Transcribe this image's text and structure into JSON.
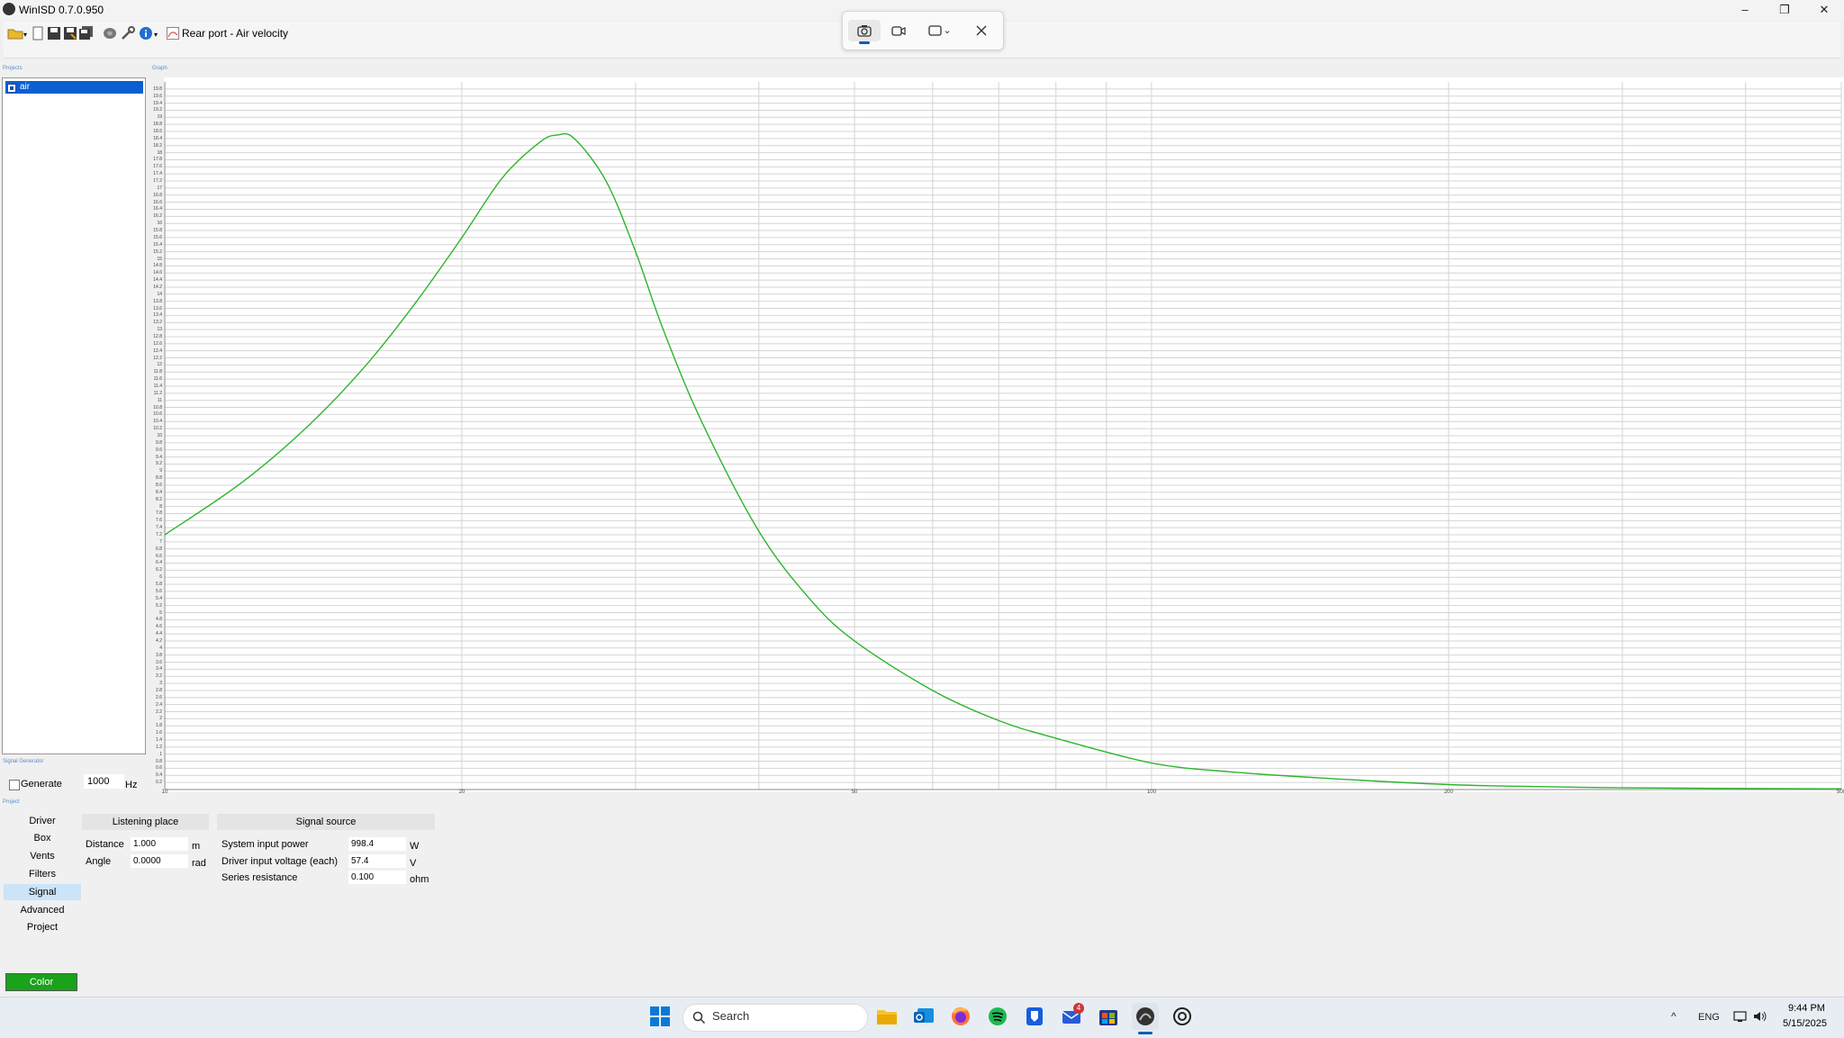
{
  "window": {
    "title": "WinISD 0.7.0.950",
    "icon": "winisd-app-icon",
    "controls": {
      "minimize": "–",
      "restore": "❐",
      "close": "✕"
    }
  },
  "toolbar": {
    "icons": [
      "open-folder-icon",
      "new-document-icon",
      "save-icon",
      "save-as-icon",
      "save-all-icon",
      "driver-database-icon",
      "tools-icon",
      "info-icon"
    ],
    "graph_selector_label": "Rear port - Air velocity",
    "graph_selector_icon": "graph-icon"
  },
  "snipping_tool": {
    "icons": [
      "camera-icon",
      "video-icon",
      "rectangle-mode-icon",
      "close-icon"
    ],
    "chevron": "⌄",
    "active_mode": "camera"
  },
  "projects_panel": {
    "label": "Projects",
    "items": [
      {
        "label": "air",
        "checked": true,
        "selected": true
      }
    ]
  },
  "graph_label": "Graph",
  "chart_data": {
    "type": "line",
    "x_scale": "log",
    "xlim": [
      10,
      500
    ],
    "ylim": [
      0,
      20
    ],
    "x_tick_labels": [
      {
        "value": 10,
        "label": "10"
      },
      {
        "value": 20,
        "label": "20"
      },
      {
        "value": 50,
        "label": "50"
      },
      {
        "value": 100,
        "label": "100"
      },
      {
        "value": 200,
        "label": "200"
      },
      {
        "value": 500,
        "label": "500"
      }
    ],
    "x_gridlines": [
      10,
      20,
      30,
      40,
      50,
      60,
      70,
      80,
      90,
      100,
      200,
      300,
      400,
      500
    ],
    "y_tick_step": 0.2,
    "y_tick_labels_shown": [
      "0.2",
      "0.4",
      "0.6",
      "0.8",
      "1",
      "1.2",
      "1.4",
      "1.6",
      "1.8",
      "2",
      "2.2",
      "2.4",
      "2.6",
      "2.8",
      "3",
      "3.2",
      "3.4",
      "3.6",
      "3.8",
      "4",
      "4.2",
      "4.4",
      "4.6",
      "4.8",
      "5",
      "5.2",
      "5.4",
      "5.6",
      "5.8",
      "6",
      "6.2",
      "6.4",
      "6.6",
      "6.8",
      "7",
      "7.2",
      "7.4",
      "7.6",
      "7.8",
      "8",
      "8.2",
      "8.4",
      "8.6",
      "8.8",
      "9",
      "9.2",
      "9.4",
      "9.6",
      "9.8",
      "10",
      "10.2",
      "10.4",
      "10.6",
      "10.8",
      "11",
      "11.2",
      "11.4",
      "11.6",
      "11.8",
      "12",
      "12.2",
      "12.4",
      "12.6",
      "12.8",
      "13",
      "13.2",
      "13.4",
      "13.6",
      "13.8",
      "14",
      "14.2",
      "14.4",
      "14.6",
      "14.8",
      "15",
      "15.2",
      "15.4",
      "15.6",
      "15.8",
      "16",
      "16.2",
      "16.4",
      "16.6",
      "16.8",
      "17",
      "17.2",
      "17.4",
      "17.6",
      "17.8",
      "18",
      "18.2",
      "18.4",
      "18.6",
      "18.8",
      "19",
      "19.2",
      "19.4",
      "19.6",
      "19.8"
    ],
    "grid": true,
    "series": [
      {
        "name": "air",
        "color": "#2db52d",
        "x": [
          10,
          12,
          14,
          16,
          18,
          20,
          22,
          24,
          25,
          26,
          28,
          30,
          32,
          35,
          40,
          45,
          50,
          60,
          70,
          80,
          100,
          120,
          150,
          200,
          250,
          300,
          400,
          500
        ],
        "y": [
          7.2,
          8.7,
          10.3,
          12.0,
          13.8,
          15.6,
          17.3,
          18.3,
          18.5,
          18.4,
          17.2,
          15.2,
          13.0,
          10.4,
          7.3,
          5.4,
          4.2,
          2.8,
          1.95,
          1.45,
          0.75,
          0.5,
          0.32,
          0.14,
          0.08,
          0.05,
          0.03,
          0.02
        ]
      }
    ]
  },
  "signal_generator": {
    "label": "Signal Generator",
    "generate_label": "Generate",
    "checked": false,
    "frequency": "1000",
    "unit": "Hz"
  },
  "project_label": "Project",
  "nav": {
    "items": [
      "Driver",
      "Box",
      "Vents",
      "Filters",
      "Signal",
      "Advanced",
      "Project"
    ],
    "selected": "Signal"
  },
  "listening_place": {
    "header": "Listening place",
    "distance_label": "Distance",
    "distance_value": "1.000",
    "distance_unit": "m",
    "angle_label": "Angle",
    "angle_value": "0.0000",
    "angle_unit": "rad"
  },
  "signal_source": {
    "header": "Signal source",
    "power_label": "System input power",
    "power_value": "998.4",
    "power_unit": "W",
    "voltage_label": "Driver input voltage (each)",
    "voltage_value": "57.4",
    "voltage_unit": "V",
    "resistance_label": "Series resistance",
    "resistance_value": "0.100",
    "resistance_unit": "ohm"
  },
  "color_button": {
    "label": "Color",
    "color": "#1aa21a"
  },
  "taskbar": {
    "search_label": "Search",
    "apps": [
      "windows-start-icon",
      "file-explorer-icon",
      "outlook-icon",
      "firefox-icon",
      "spotify-icon",
      "bitwarden-icon",
      "mail-icon",
      "microsoft-store-icon",
      "winisd-taskbar-icon",
      "chatgpt-icon"
    ],
    "mail_badge": "4",
    "tray": {
      "chevron": "^",
      "language": "ENG",
      "network_icon": "network-icon",
      "volume_icon": "volume-icon"
    },
    "time": "9:44 PM",
    "date": "5/15/2025"
  }
}
